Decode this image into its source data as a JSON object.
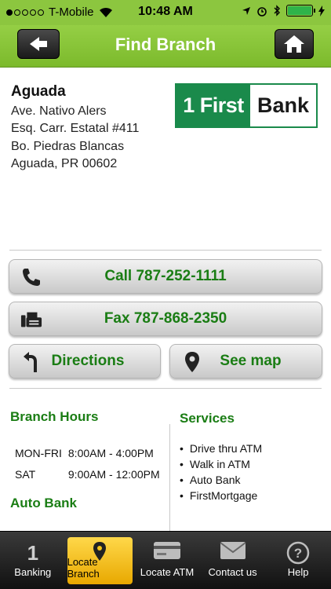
{
  "status": {
    "carrier": "T-Mobile",
    "time": "10:48 AM"
  },
  "nav": {
    "title": "Find Branch",
    "back_icon": "back-arrow-icon",
    "home_icon": "home-icon"
  },
  "branch": {
    "name": "Aguada",
    "address_lines": [
      "Ave. Nativo Alers",
      "Esq. Carr. Estatal #411",
      "Bo. Piedras Blancas",
      "Aguada, PR 00602"
    ]
  },
  "logo": {
    "mark": "1 First",
    "word": "Bank",
    "color": "#1a8a4b"
  },
  "actions": {
    "call": "Call 787-252-1111",
    "fax": "Fax 787-868-2350",
    "directions": "Directions",
    "see_map": "See map"
  },
  "hours": {
    "title": "Branch Hours",
    "rows": [
      {
        "days": "MON-FRI",
        "time": "8:00AM - 4:00PM"
      },
      {
        "days": "SAT",
        "time": "9:00AM - 12:00PM"
      }
    ],
    "auto_bank_title": "Auto Bank"
  },
  "services": {
    "title": "Services",
    "items": [
      "Drive thru ATM",
      "Walk in ATM",
      "Auto Bank",
      "FirstMortgage"
    ]
  },
  "tabs": [
    {
      "label": "Banking",
      "icon": "first-bank-one-icon"
    },
    {
      "label": "Locate Branch",
      "icon": "location-pin-icon"
    },
    {
      "label": "Locate ATM",
      "icon": "credit-card-icon"
    },
    {
      "label": "Contact us",
      "icon": "envelope-icon"
    },
    {
      "label": "Help",
      "icon": "help-icon"
    }
  ],
  "colors": {
    "brand_green": "#8cc63f",
    "label_green": "#1a7d14",
    "active_tab": "#f5c518"
  }
}
